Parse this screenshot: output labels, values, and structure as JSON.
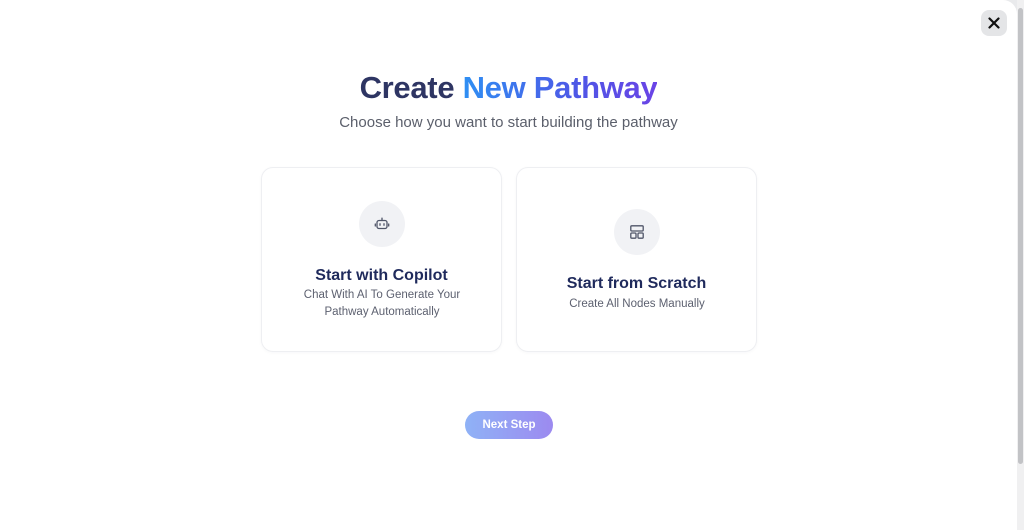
{
  "dialog": {
    "title_plain": "Create",
    "title_accent": "New Pathway",
    "subtitle": "Choose how you want to start building the pathway",
    "close_icon": "close-icon"
  },
  "options": [
    {
      "icon": "robot-icon",
      "title": "Start with Copilot",
      "description": "Chat With AI To Generate Your Pathway Automatically"
    },
    {
      "icon": "layout-icon",
      "title": "Start from Scratch",
      "description": "Create All Nodes Manually"
    }
  ],
  "actions": {
    "next_label": "Next Step"
  },
  "colors": {
    "title_plain": "#2e3563",
    "title_accent_start": "#2f8ff3",
    "title_accent_end": "#6a43e6",
    "card_title": "#1f2a5c",
    "next_button_start": "#8fb2f6",
    "next_button_end": "#9c8af0"
  }
}
